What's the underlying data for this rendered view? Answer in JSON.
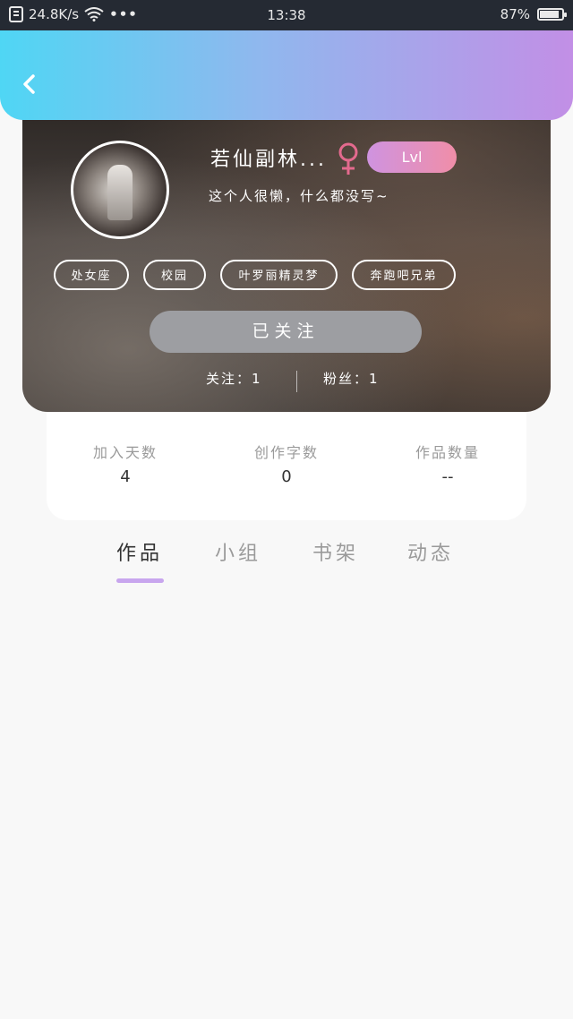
{
  "status_bar": {
    "net_speed": "24.8K/s",
    "more": "•••",
    "time": "13:38",
    "battery": "87%",
    "battery_level": 0.87
  },
  "profile": {
    "username": "若仙副林...",
    "gender": "female",
    "level": "Lvl",
    "bio": "这个人很懒，什么都没写~",
    "tags": [
      "处女座",
      "校园",
      "叶罗丽精灵梦",
      "奔跑吧兄弟"
    ],
    "follow_button": "已关注",
    "following": "关注：1",
    "fans": "粉丝：1"
  },
  "stats": [
    {
      "label": "加入天数",
      "value": "4"
    },
    {
      "label": "创作字数",
      "value": "0"
    },
    {
      "label": "作品数量",
      "value": "--"
    }
  ],
  "tabs": [
    "作品",
    "小组",
    "书架",
    "动态"
  ],
  "colors": {
    "header_gradient_start": "#4fd6f4",
    "header_gradient_end": "#c28fe6",
    "level_badge": "#e090c8",
    "tab_indicator": "#c8a6ee",
    "gender_icon": "#e46a8e"
  }
}
